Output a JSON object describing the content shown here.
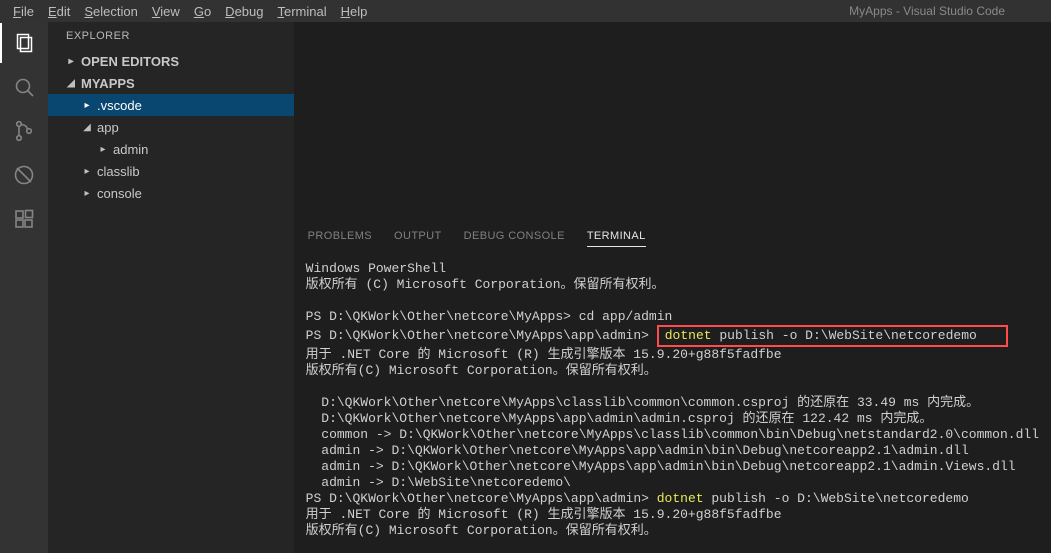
{
  "title": "MyApps - Visual Studio Code",
  "menubar": [
    {
      "label": "File",
      "mn": "F"
    },
    {
      "label": "Edit",
      "mn": "E"
    },
    {
      "label": "Selection",
      "mn": "S"
    },
    {
      "label": "View",
      "mn": "V"
    },
    {
      "label": "Go",
      "mn": "G"
    },
    {
      "label": "Debug",
      "mn": "D"
    },
    {
      "label": "Terminal",
      "mn": "T"
    },
    {
      "label": "Help",
      "mn": "H"
    }
  ],
  "sidebar": {
    "title": "EXPLORER",
    "rows": [
      {
        "label": "OPEN EDITORS",
        "indent": 0,
        "expanded": false,
        "bold": true,
        "selected": false
      },
      {
        "label": "MYAPPS",
        "indent": 0,
        "expanded": true,
        "bold": true,
        "selected": false
      },
      {
        "label": ".vscode",
        "indent": 1,
        "expanded": false,
        "bold": false,
        "selected": true
      },
      {
        "label": "app",
        "indent": 1,
        "expanded": true,
        "bold": false,
        "selected": false
      },
      {
        "label": "admin",
        "indent": 2,
        "expanded": false,
        "bold": false,
        "selected": false
      },
      {
        "label": "classlib",
        "indent": 1,
        "expanded": false,
        "bold": false,
        "selected": false
      },
      {
        "label": "console",
        "indent": 1,
        "expanded": false,
        "bold": false,
        "selected": false
      }
    ]
  },
  "panel": {
    "tabs": [
      "PROBLEMS",
      "OUTPUT",
      "DEBUG CONSOLE",
      "TERMINAL"
    ],
    "active": "TERMINAL"
  },
  "terminal": {
    "header1": "Windows PowerShell",
    "header2": "版权所有 (C) Microsoft Corporation。保留所有权利。",
    "prompt1": "PS D:\\QKWork\\Other\\netcore\\MyApps>",
    "cmd1": " cd app/admin",
    "prompt2": "PS D:\\QKWork\\Other\\netcore\\MyApps\\app\\admin>",
    "boxed_cmd_yellow": "dotnet",
    "boxed_cmd_rest": " publish -o D:\\WebSite\\netcoredemo",
    "build_line1": "用于 .NET Core 的 Microsoft (R) 生成引擎版本 15.9.20+g88f5fadfbe",
    "build_line2": "版权所有(C) Microsoft Corporation。保留所有权利。",
    "restore1": "  D:\\QKWork\\Other\\netcore\\MyApps\\classlib\\common\\common.csproj 的还原在 33.49 ms 内完成。",
    "restore2": "  D:\\QKWork\\Other\\netcore\\MyApps\\app\\admin\\admin.csproj 的还原在 122.42 ms 内完成。",
    "out1": "  common -> D:\\QKWork\\Other\\netcore\\MyApps\\classlib\\common\\bin\\Debug\\netstandard2.0\\common.dll",
    "out2": "  admin -> D:\\QKWork\\Other\\netcore\\MyApps\\app\\admin\\bin\\Debug\\netcoreapp2.1\\admin.dll",
    "out3": "  admin -> D:\\QKWork\\Other\\netcore\\MyApps\\app\\admin\\bin\\Debug\\netcoreapp2.1\\admin.Views.dll",
    "out4": "  admin -> D:\\WebSite\\netcoredemo\\",
    "prompt3": "PS D:\\QKWork\\Other\\netcore\\MyApps\\app\\admin>",
    "cmd3_yellow": "dotnet",
    "cmd3_rest": " publish -o D:\\WebSite\\netcoredemo",
    "build2_line1": "用于 .NET Core 的 Microsoft (R) 生成引擎版本 15.9.20+g88f5fadfbe",
    "build2_line2": "版权所有(C) Microsoft Corporation。保留所有权利。"
  }
}
